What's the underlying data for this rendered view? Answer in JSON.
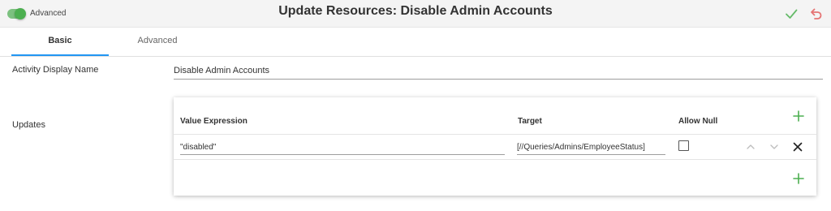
{
  "header": {
    "toggle_label": "Advanced",
    "title": "Update Resources: Disable Admin Accounts",
    "confirm_icon": "checkmark-icon",
    "undo_icon": "undo-icon"
  },
  "tabs": [
    {
      "label": "Basic",
      "active": true
    },
    {
      "label": "Advanced",
      "active": false
    }
  ],
  "form": {
    "display_name_label": "Activity Display Name",
    "display_name_value": "Disable Admin Accounts",
    "updates_label": "Updates"
  },
  "updates": {
    "columns": [
      "Value Expression",
      "Target",
      "Allow Null"
    ],
    "rows": [
      {
        "value_expression": "\"disabled\"",
        "target": "[//Queries/Admins/EmployeeStatus]",
        "allow_null": false
      }
    ]
  },
  "colors": {
    "accent": "#2196f3",
    "toggle_on": "#4caf50",
    "confirm": "#66bb6a",
    "undo": "#e57373"
  }
}
